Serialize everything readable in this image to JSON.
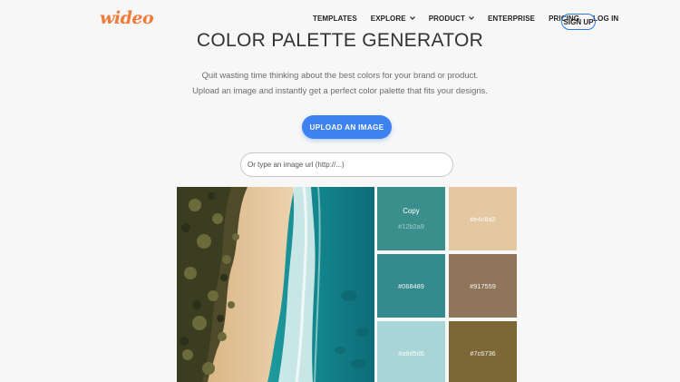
{
  "header": {
    "logo": "wideo",
    "nav": [
      {
        "label": "TEMPLATES",
        "dropdown": false
      },
      {
        "label": "EXPLORE",
        "dropdown": true
      },
      {
        "label": "PRODUCT",
        "dropdown": true
      },
      {
        "label": "ENTERPRISE",
        "dropdown": false
      },
      {
        "label": "PRICING",
        "dropdown": false
      },
      {
        "label": "LOG IN",
        "dropdown": false
      }
    ],
    "signup_label": "SIGN UP"
  },
  "hero": {
    "title": "COLOR PALETTE GENERATOR",
    "subtitle_line1": "Quit wasting time thinking about the best colors for your brand or product.",
    "subtitle_line2": "Upload an image and instantly get a perfect color palette that fits your designs.",
    "upload_label": "UPLOAD AN IMAGE",
    "url_placeholder": "Or type an image url (http://...)"
  },
  "palette": {
    "copy_label": "Copy",
    "swatches": [
      {
        "hex": "#12b2a9",
        "color": "#3a8f8c"
      },
      {
        "hex": "#e4c8a2",
        "color": "#e4c8a2"
      },
      {
        "hex": "#068489",
        "color": "#358a8d"
      },
      {
        "hex": "#917559",
        "color": "#8f7559"
      },
      {
        "hex": "#a9d5d6",
        "color": "#a9d5d6"
      },
      {
        "hex": "#7c6736",
        "color": "#7c6736"
      }
    ]
  },
  "icons": {
    "dropdown": "chevron-down-icon"
  }
}
